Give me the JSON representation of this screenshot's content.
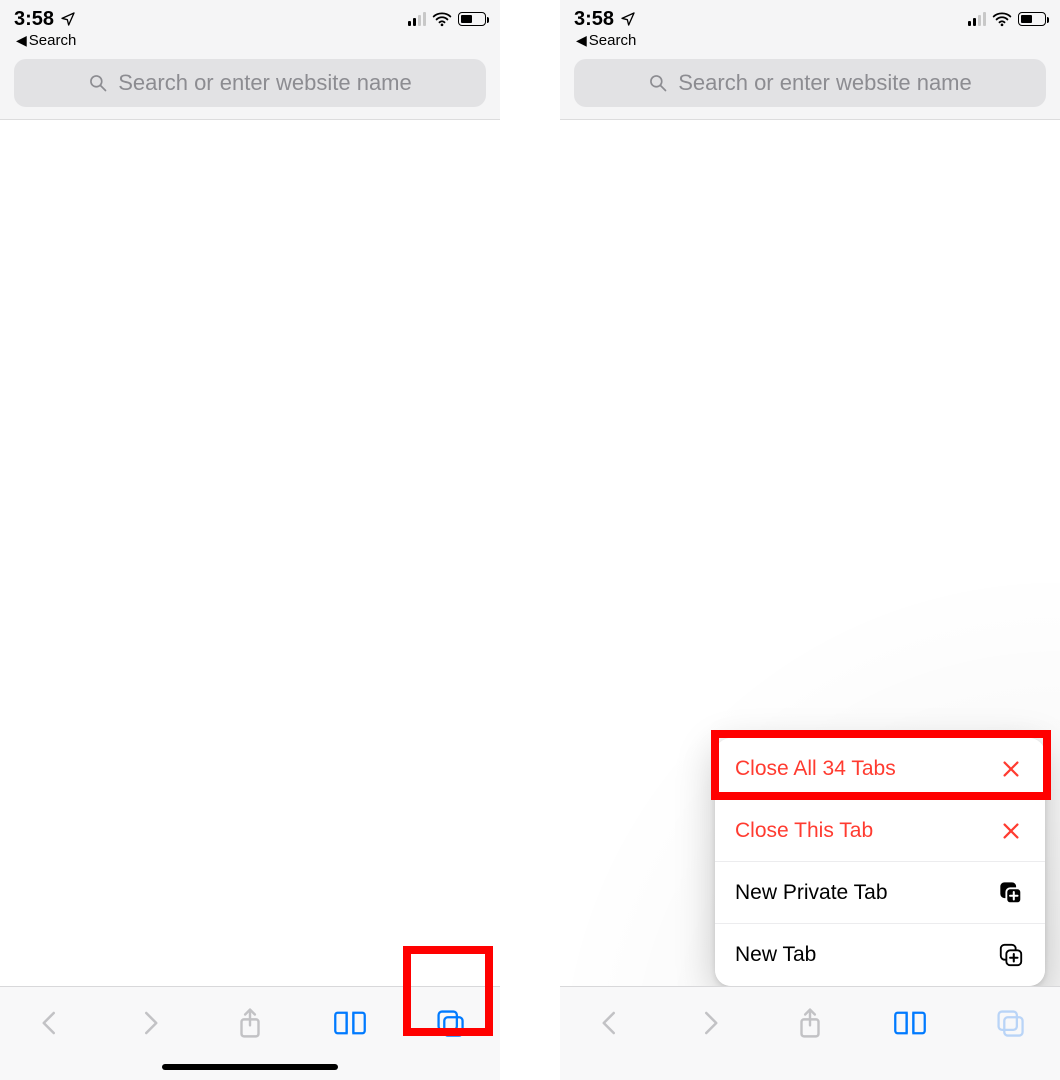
{
  "status": {
    "time": "3:58",
    "back_app_label": "Search",
    "battery_percent": 50
  },
  "url_bar": {
    "placeholder": "Search or enter website name"
  },
  "menu": {
    "close_all_label": "Close All 34 Tabs",
    "close_this_label": "Close This Tab",
    "new_private_label": "New Private Tab",
    "new_tab_label": "New Tab"
  },
  "colors": {
    "ios_blue": "#007aff",
    "ios_red": "#ff3b30",
    "highlight": "#ff0000"
  }
}
